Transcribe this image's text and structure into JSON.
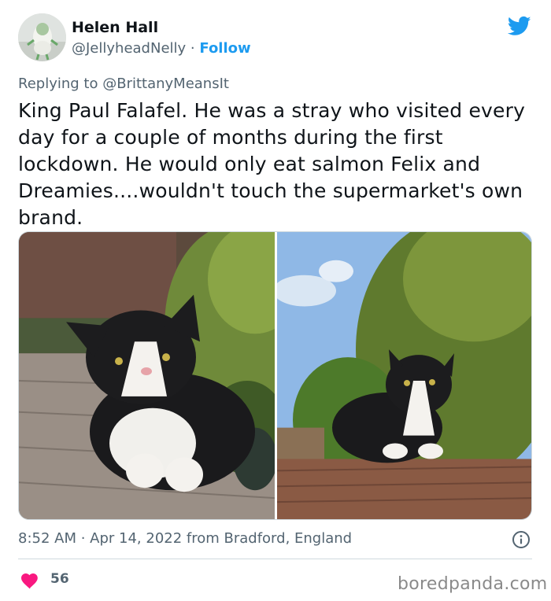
{
  "author": {
    "name": "Helen Hall",
    "handle": "@JellyheadNelly",
    "separator": "·",
    "follow_label": "Follow",
    "avatar_icon": "avatar-image"
  },
  "reply": {
    "prefix": "Replying to",
    "mention": "@BrittanyMeansIt"
  },
  "tweet": {
    "text": "King Paul Falafel. He was a stray who visited every day for a couple of months during the first lockdown. He would only eat salmon Felix and Dreamies....wouldn't  touch the supermarket's own brand."
  },
  "meta": {
    "timestamp": "8:52 AM · Apr 14, 2022 from Bradford, England"
  },
  "engagement": {
    "likes": "56",
    "like_icon": "heart-icon",
    "info_icon": "info-icon"
  },
  "watermark": "boredpanda.com",
  "colors": {
    "accent": "#1d9bf0",
    "like": "#f91880",
    "secondary_text": "#536471"
  }
}
